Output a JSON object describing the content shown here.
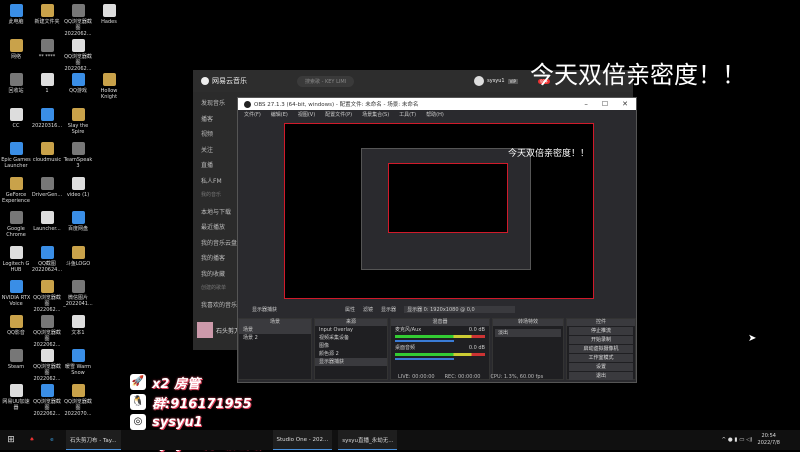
{
  "desktop": {
    "icons": [
      [
        "此电脑",
        "新建文件夹",
        "QQ浏览器截图2022062...",
        "Hades"
      ],
      [
        "网络",
        "** ****",
        "QQ浏览器截图2022062...",
        ""
      ],
      [
        "回收站",
        "1",
        "QQ游戏",
        "Hollow Knight"
      ],
      [
        "CC",
        "20220316...",
        "Slay the Spire",
        ""
      ],
      [
        "Epic Games Launcher",
        "cloudmusic",
        "TeamSpeak 3",
        ""
      ],
      [
        "GeForce Experience",
        "DriverGen...",
        "video (1)",
        ""
      ],
      [
        "Google Chrome",
        "Launcher...",
        "百度网盘",
        ""
      ],
      [
        "Logitech G HUB",
        "QQ截图20220624...",
        "斗鱼LOGO",
        ""
      ],
      [
        "NVIDIA RTX Voice",
        "QQ浏览器截图2022062...",
        "微信图片_2022041...",
        ""
      ],
      [
        "QQ影音",
        "QQ浏览器截图2022062...",
        "文本1",
        ""
      ],
      [
        "Steam",
        "QQ浏览器截图2022062...",
        "暖雪 Warm Snow",
        ""
      ],
      [
        "网易UU加速器",
        "QQ浏览器截图2022062...",
        "QQ浏览器截图2022070...",
        ""
      ]
    ]
  },
  "netease": {
    "app_name": "网易云音乐",
    "search_placeholder": "搜索歌 - KEY LIMI",
    "user": "sysyu1",
    "vip": "VIP",
    "badge": "99+",
    "sidebar": [
      "发现音乐",
      "播客",
      "视频",
      "关注",
      "直播",
      "私人FM",
      "我的音乐",
      "本地与下载",
      "最近播放",
      "我的音乐云盘",
      "我的播客",
      "我的收藏",
      "创建的歌单",
      "我喜欢的音乐"
    ],
    "now_playing": {
      "title": "石头剪刀布",
      "artist": "Tay"
    }
  },
  "obs": {
    "title": "OBS 27.1.3 (64-bit, windows) - 配置文件: 未命名 - 场景: 未命名",
    "menu": [
      "文件(F)",
      "编辑(E)",
      "视图(V)",
      "配置文件(P)",
      "场景集合(S)",
      "工具(T)",
      "帮助(H)"
    ],
    "source_bar": {
      "source": "显示器捕获",
      "properties": "属性",
      "filters": "滤镜",
      "display_label": "显示器",
      "display_value": "显示器 0: 1920x1080 @ 0,0"
    },
    "docks": {
      "scenes": "场景",
      "sources": "来源",
      "mixer": "混音器",
      "transitions": "转场特效",
      "controls": "控件"
    },
    "scenes": [
      "场景",
      "场景 2"
    ],
    "sources": [
      "Input Overlay",
      "视频采集设备",
      "图像",
      "颜色源 2",
      "显示器捕获"
    ],
    "mixer": [
      {
        "name": "麦克风/Aux",
        "db": "0.0 dB"
      },
      {
        "name": "桌面音频",
        "db": "0.0 dB"
      }
    ],
    "transition": "淡出",
    "controls": [
      "停止推流",
      "开始录制",
      "启动虚拟摄像机",
      "工作室模式",
      "设置",
      "退出"
    ],
    "status": {
      "live": "LIVE: 00:00:00",
      "rec": "REC: 00:00:00",
      "cpu": "CPU: 1.3%, 60.00 fps"
    }
  },
  "banner": "今天双倍亲密度！！",
  "overlay": [
    {
      "icon": "rocket",
      "text": "x2 房管"
    },
    {
      "icon": "qq",
      "text": "群:916171955"
    },
    {
      "icon": "netease",
      "text": "sysyu1"
    },
    {
      "icon": "douyin",
      "text": "sysyu（永劫无间）"
    }
  ],
  "taskbar": {
    "items": [
      "石头剪刀布 - Tay...",
      "Studio One - 202...",
      "sysyu直播_永劫无..."
    ],
    "time": "20:54",
    "date": "2022/7/8"
  }
}
